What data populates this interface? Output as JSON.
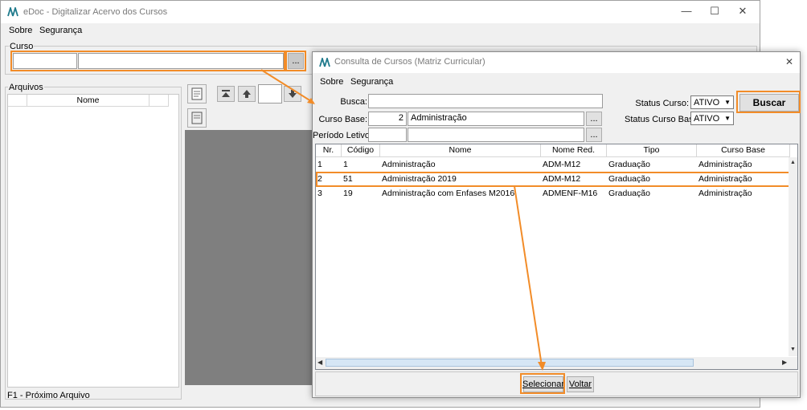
{
  "main": {
    "title": "eDoc - Digitalizar Acervo dos Cursos",
    "menu": {
      "sobre": "Sobre",
      "seguranca": "Segurança"
    },
    "curso_label": "Curso",
    "curso_browse": "...",
    "arquivos_label": "Arquivos",
    "files_columns": [
      "",
      "Nome",
      ""
    ],
    "status_text": "F1 - Próximo Arquivo",
    "controls": {
      "minimize": "—",
      "maximize": "☐",
      "close": "✕"
    }
  },
  "dialog": {
    "title": "Consulta de Cursos (Matriz Curricular)",
    "close": "✕",
    "menu": {
      "sobre": "Sobre",
      "seguranca": "Segurança"
    },
    "busca_label": "Busca:",
    "busca_value": "",
    "curso_base_label": "Curso Base:",
    "curso_base_code": "2",
    "curso_base_name": "Administração",
    "periodo_label": "Período Letivo:",
    "browse": "...",
    "status_curso_label": "Status Curso:",
    "status_curso_value": "ATIVO",
    "status_curso_base_label": "Status Curso Base:",
    "status_curso_base_value": "ATIVO",
    "buscar": "Buscar",
    "columns": [
      "Nr.",
      "Código",
      "Nome",
      "Nome Red.",
      "Tipo",
      "Curso Base"
    ],
    "rows": [
      [
        "1",
        "1",
        "Administração",
        "ADM-M12",
        "Graduação",
        "Administração"
      ],
      [
        "2",
        "51",
        "Administração 2019",
        "ADM-M12",
        "Graduação",
        "Administração"
      ],
      [
        "3",
        "19",
        "Administração com Enfases M2016",
        "ADMENF-M16",
        "Graduação",
        "Administração"
      ]
    ],
    "selecionar": "Selecionar",
    "voltar": "Voltar"
  },
  "colors": {
    "highlight": "#f28c28",
    "panel": "#f0f0f0",
    "dark_area": "#7f7f7f"
  }
}
